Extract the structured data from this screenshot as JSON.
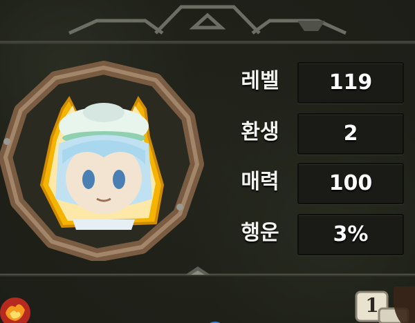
{
  "stats": [
    {
      "label": "레벨",
      "value": "119"
    },
    {
      "label": "환생",
      "value": "2"
    },
    {
      "label": "매력",
      "value": "100"
    },
    {
      "label": "행운",
      "value": "3%"
    }
  ],
  "hotkey": {
    "number": "1"
  },
  "colors": {
    "background": "#1f2119",
    "frame_wood": "#8a6b4f",
    "portrait_glow": "#f5b400",
    "value_box": "#1a1a17",
    "text": "#ffffff"
  },
  "icons": {
    "character": "character-portrait",
    "bottom_left": "fire-emblem-icon",
    "hotkey": "hotkey-badge-icon"
  }
}
